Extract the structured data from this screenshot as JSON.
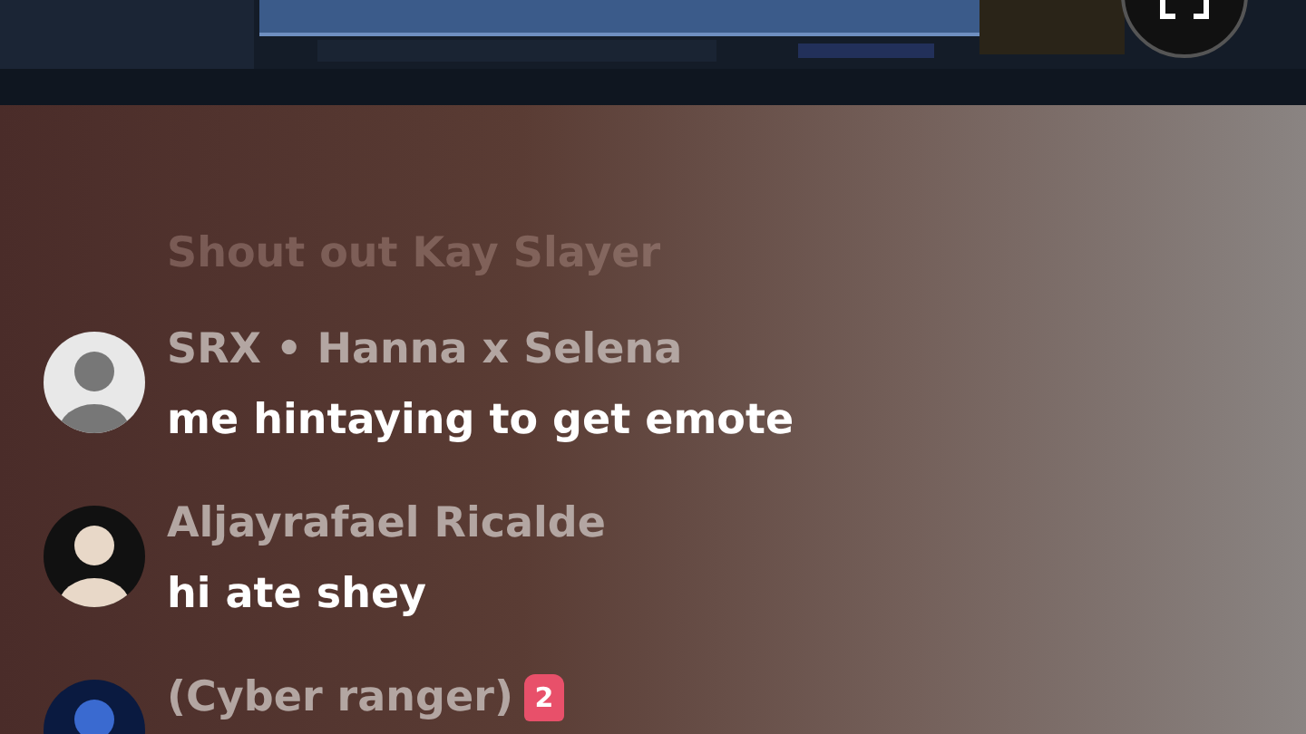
{
  "faded_message": {
    "text": "Shout out Kay Slayer"
  },
  "comments": [
    {
      "name": "SRX • Hanna x Selena",
      "message": "me hintaying to get emote"
    },
    {
      "name": "Aljayrafael Ricalde",
      "message": "hi ate shey"
    },
    {
      "name": "(Cyber ranger)",
      "badge": "2"
    }
  ]
}
